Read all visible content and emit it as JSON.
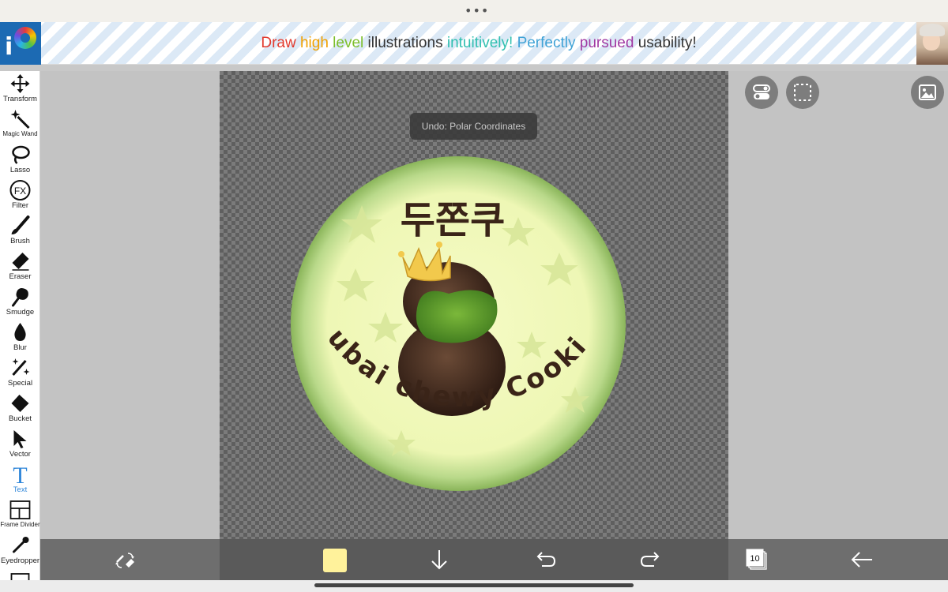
{
  "status": {
    "more_dots": "•••"
  },
  "ad_banner": {
    "logo_letter": "i",
    "words": [
      "Draw",
      "high",
      "level",
      "illustrations",
      "intuitively!",
      "Perfectly",
      "pursued",
      "usability!"
    ]
  },
  "tools": [
    {
      "label": "Transform",
      "icon": "move-arrows-icon"
    },
    {
      "label": "Magic Wand",
      "icon": "magic-wand-icon"
    },
    {
      "label": "Lasso",
      "icon": "lasso-icon"
    },
    {
      "label": "Filter",
      "icon": "fx-icon",
      "glyph": "FX"
    },
    {
      "label": "Brush",
      "icon": "brush-icon"
    },
    {
      "label": "Eraser",
      "icon": "eraser-icon"
    },
    {
      "label": "Smudge",
      "icon": "smudge-icon"
    },
    {
      "label": "Blur",
      "icon": "droplet-icon"
    },
    {
      "label": "Special",
      "icon": "sparkle-pen-icon"
    },
    {
      "label": "Bucket",
      "icon": "bucket-icon"
    },
    {
      "label": "Vector",
      "icon": "cursor-arrow-icon"
    },
    {
      "label": "Text",
      "icon": "text-t-icon",
      "glyph": "T",
      "active": true
    },
    {
      "label": "Frame Divider",
      "icon": "frame-divider-icon"
    },
    {
      "label": "Eyedropper",
      "icon": "eyedropper-icon"
    }
  ],
  "toast": {
    "text": "Undo: Polar Coordinates"
  },
  "artwork": {
    "korean_title": "두쫀쿠",
    "arc_text": "Dubai chewy Cookie"
  },
  "bottom_bar": {
    "primary_color": "#fff29b",
    "layer_count": "10"
  },
  "colors": {
    "toolbar_bg": "#ffffff",
    "active_tool": "#2f86d9",
    "bottom_bar": "#6e6e6e",
    "canvas_bg": "#c3c3c3"
  }
}
